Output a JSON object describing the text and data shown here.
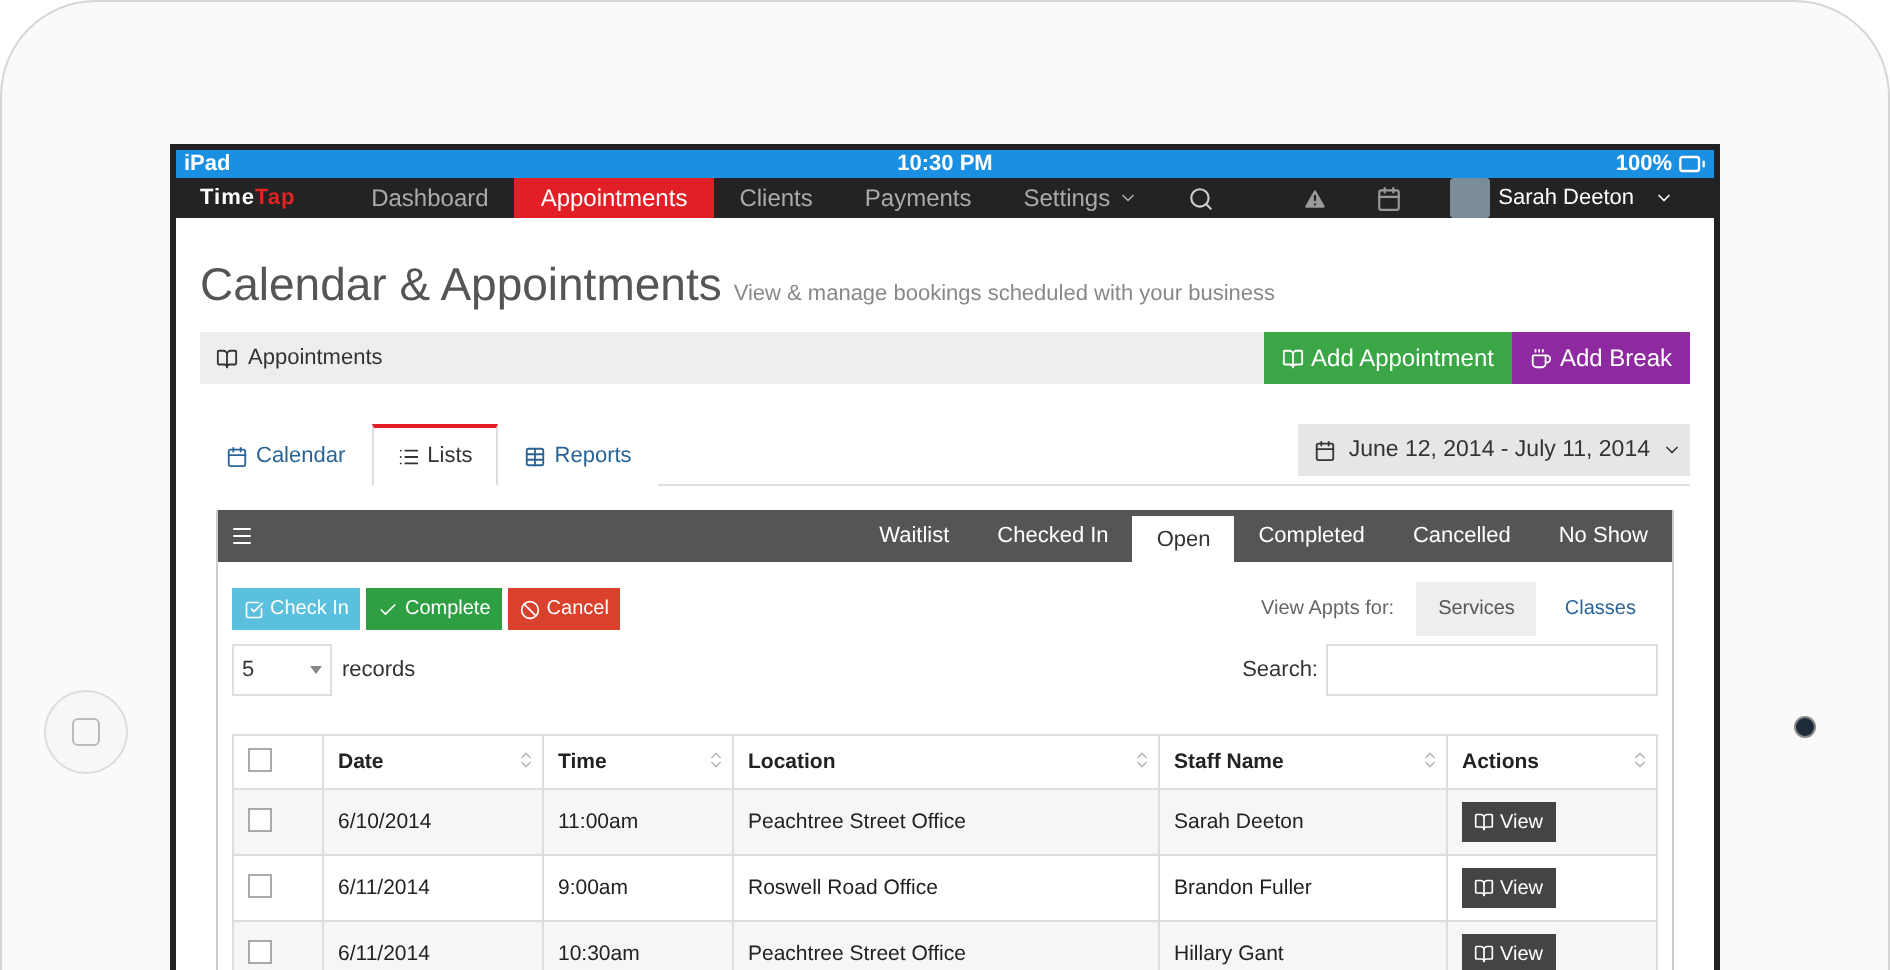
{
  "status_bar": {
    "device": "iPad",
    "time": "10:30 PM",
    "battery": "100%"
  },
  "nav": {
    "logo_first": "Time",
    "logo_second": "Tap",
    "items": [
      {
        "label": "Dashboard",
        "selected": false
      },
      {
        "label": "Appointments",
        "selected": true
      },
      {
        "label": "Clients",
        "selected": false
      },
      {
        "label": "Payments",
        "selected": false
      },
      {
        "label": "Settings",
        "selected": false
      }
    ],
    "user": "Sarah Deeton"
  },
  "header": {
    "title": "Calendar & Appointments",
    "subtitle": "View & manage bookings scheduled with your business"
  },
  "section": {
    "title": "Appointments",
    "buttons": [
      {
        "label": "Add Appointment",
        "kind": "appointment"
      },
      {
        "label": "Add Break",
        "kind": "break"
      }
    ]
  },
  "tabs": [
    {
      "label": "Calendar",
      "selected": false
    },
    {
      "label": "Lists",
      "selected": true
    },
    {
      "label": "Reports",
      "selected": false
    }
  ],
  "date_range": "June 12, 2014 - July 11, 2014",
  "status_tabs": [
    {
      "label": "Waitlist",
      "selected": false
    },
    {
      "label": "Checked In",
      "selected": false
    },
    {
      "label": "Open",
      "selected": true
    },
    {
      "label": "Completed",
      "selected": false
    },
    {
      "label": "Cancelled",
      "selected": false
    },
    {
      "label": "No Show",
      "selected": false
    }
  ],
  "actions": [
    {
      "label": "Check In",
      "kind": "checkin"
    },
    {
      "label": "Complete",
      "kind": "complete"
    },
    {
      "label": "Cancel",
      "kind": "cancel"
    }
  ],
  "view_for": {
    "label": "View Appts for:",
    "options": [
      {
        "label": "Services",
        "selected": true
      },
      {
        "label": "Classes",
        "selected": false
      }
    ]
  },
  "page_size": {
    "value": "5",
    "label": "records"
  },
  "search": {
    "label": "Search:"
  },
  "table": {
    "select_all": false,
    "columns": [
      "Date",
      "Time",
      "Location",
      "Staff Name",
      "Actions"
    ],
    "rows": [
      {
        "checked": false,
        "cells": [
          "6/10/2014",
          "11:00am",
          "Peachtree Street Office",
          "Sarah Deeton"
        ],
        "action": "View"
      },
      {
        "checked": false,
        "cells": [
          "6/11/2014",
          "9:00am",
          "Roswell Road Office",
          "Brandon Fuller"
        ],
        "action": "View"
      },
      {
        "checked": false,
        "cells": [
          "6/11/2014",
          "10:30am",
          "Peachtree Street Office",
          "Hillary Gant"
        ],
        "action": "View"
      }
    ]
  }
}
